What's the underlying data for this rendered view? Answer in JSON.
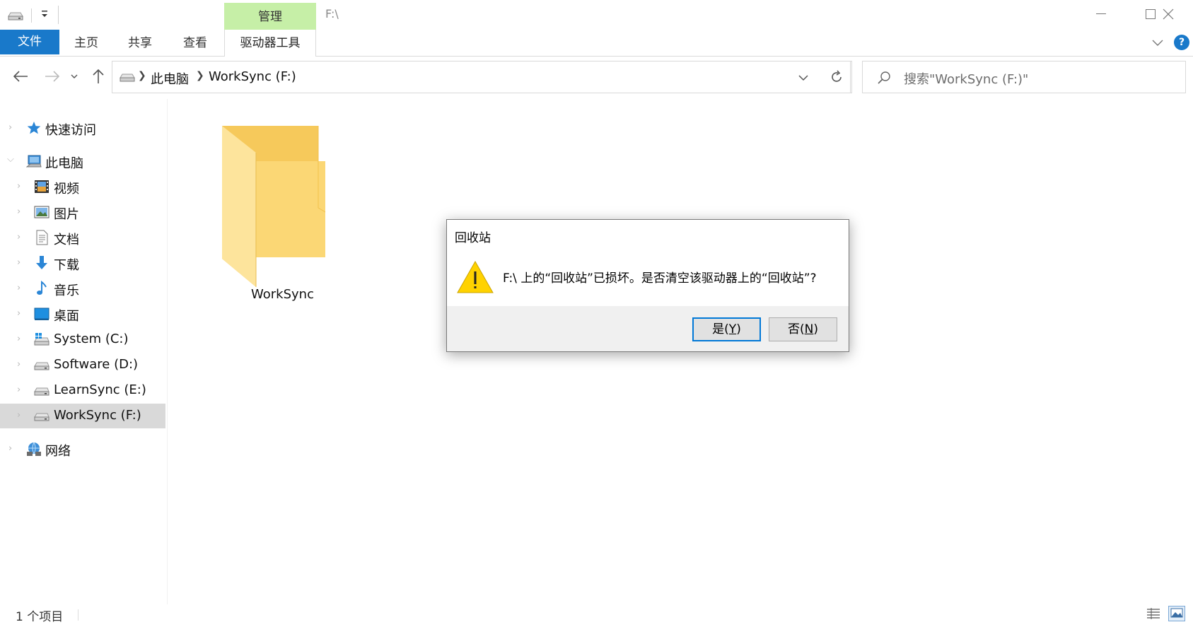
{
  "titlebar": {
    "path": "F:\\",
    "manage_tab": "管理"
  },
  "ribbon": {
    "tabs": [
      "文件",
      "主页",
      "共享",
      "查看",
      "驱动器工具"
    ]
  },
  "address": {
    "crumbs": [
      "此电脑",
      "WorkSync (F:)"
    ],
    "search_placeholder": "搜索\"WorkSync (F:)\""
  },
  "sidebar": {
    "items": [
      {
        "label": "快速访问",
        "icon": "star-icon"
      },
      {
        "label": "此电脑",
        "icon": "computer-icon"
      },
      {
        "label": "视频",
        "icon": "video-icon"
      },
      {
        "label": "图片",
        "icon": "pictures-icon"
      },
      {
        "label": "文档",
        "icon": "documents-icon"
      },
      {
        "label": "下载",
        "icon": "download-icon"
      },
      {
        "label": "音乐",
        "icon": "music-icon"
      },
      {
        "label": "桌面",
        "icon": "desktop-icon"
      },
      {
        "label": "System (C:)",
        "icon": "system-drive-icon"
      },
      {
        "label": "Software (D:)",
        "icon": "drive-icon"
      },
      {
        "label": "LearnSync (E:)",
        "icon": "drive-icon"
      },
      {
        "label": "WorkSync (F:)",
        "icon": "drive-icon"
      },
      {
        "label": "网络",
        "icon": "network-icon"
      }
    ]
  },
  "content": {
    "items": [
      {
        "name": "WorkSync",
        "type": "folder"
      }
    ]
  },
  "status": {
    "count_text": "1 个项目"
  },
  "dialog": {
    "title": "回收站",
    "message": "F:\\ 上的“回收站”已损坏。是否清空该驱动器上的“回收站”?",
    "yes_prefix": "是(",
    "yes_key": "Y",
    "yes_suffix": ")",
    "no_prefix": "否(",
    "no_key": "N",
    "no_suffix": ")"
  },
  "colors": {
    "accent": "#1979ca",
    "manage_tab": "#c6efa7",
    "selected": "#d9d9d9",
    "folder": "#f8d775"
  }
}
